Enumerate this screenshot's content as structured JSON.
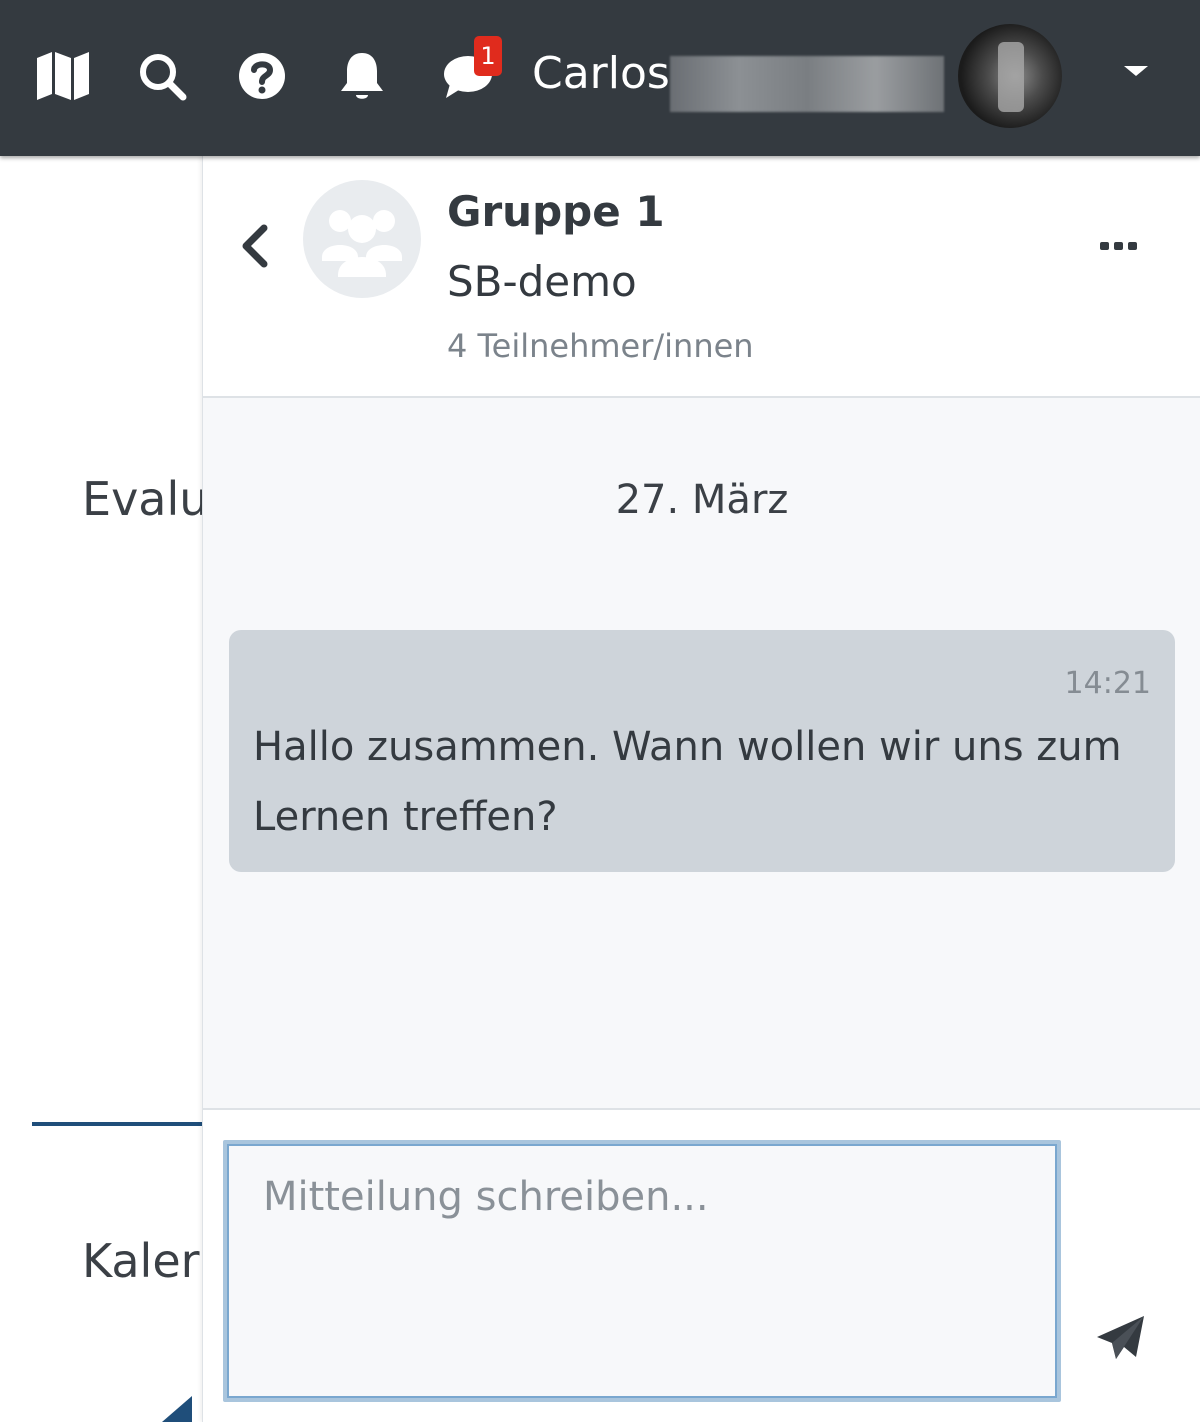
{
  "navbar": {
    "notification_count": "1",
    "user_first_name": "Carlos",
    "icons": [
      "map-icon",
      "search-icon",
      "help-icon",
      "bell-icon",
      "chat-icon"
    ]
  },
  "background": {
    "item1": "Evalu",
    "item2": "Kaler"
  },
  "chat": {
    "group_name": "Gruppe 1",
    "course_name": "SB-demo",
    "members": "4 Teilnehmer/innen",
    "date": "27. März",
    "messages": [
      {
        "time": "14:21",
        "text": "Hallo zusammen. Wann wollen wir uns zum Lernen treffen?"
      }
    ],
    "input_placeholder": "Mitteilung schreiben...",
    "input_value": ""
  },
  "colors": {
    "navbar_bg": "#343a40",
    "badge": "#e02b1d",
    "message_bubble": "#ced4da",
    "accent": "#1f4e7a"
  }
}
